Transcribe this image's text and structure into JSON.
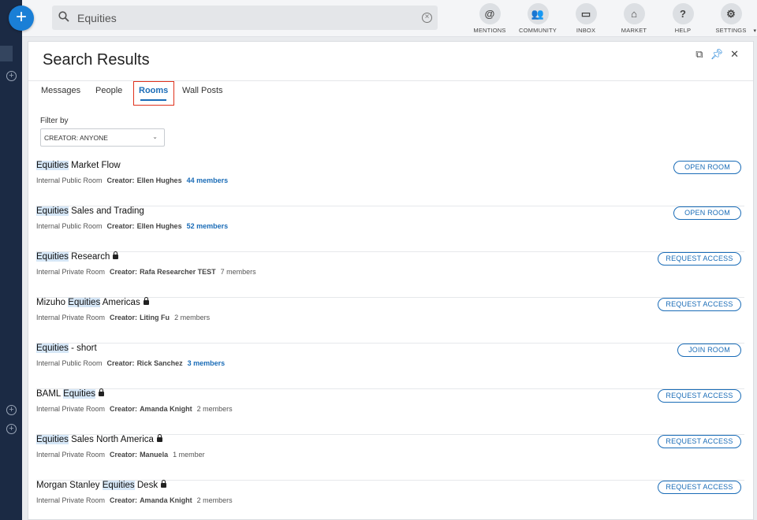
{
  "search": {
    "query": "Equities"
  },
  "nav": [
    {
      "label": "MENTIONS",
      "glyph": "@"
    },
    {
      "label": "COMMUNITY",
      "glyph": "👥"
    },
    {
      "label": "INBOX",
      "glyph": "▭"
    },
    {
      "label": "MARKET",
      "glyph": "⌂"
    },
    {
      "label": "HELP",
      "glyph": "?"
    },
    {
      "label": "SETTINGS",
      "glyph": "⚙"
    }
  ],
  "panel": {
    "title": "Search Results"
  },
  "tabs": [
    "Messages",
    "People",
    "Rooms",
    "Wall Posts"
  ],
  "active_tab": "Rooms",
  "filter": {
    "label": "Filter by",
    "value": "CREATOR: ANYONE"
  },
  "creator_label": "Creator:",
  "rooms": [
    {
      "pre": "",
      "hl": "Equities",
      "post": " Market Flow",
      "private": false,
      "type": "Internal Public Room",
      "creator": "Ellen Hughes",
      "members": "44 members",
      "members_link": true,
      "action": "OPEN ROOM"
    },
    {
      "pre": "",
      "hl": "Equities",
      "post": " Sales and Trading",
      "private": false,
      "type": "Internal Public Room",
      "creator": "Ellen Hughes",
      "members": "52 members",
      "members_link": true,
      "action": "OPEN ROOM"
    },
    {
      "pre": "",
      "hl": "Equities",
      "post": " Research",
      "private": true,
      "type": "Internal Private Room",
      "creator": "Rafa Researcher TEST",
      "members": "7 members",
      "members_link": false,
      "action": "REQUEST ACCESS"
    },
    {
      "pre": "Mizuho ",
      "hl": "Equities",
      "post": " Americas",
      "private": true,
      "type": "Internal Private Room",
      "creator": "Liting Fu",
      "members": "2 members",
      "members_link": false,
      "action": "REQUEST ACCESS"
    },
    {
      "pre": "",
      "hl": "Equities",
      "post": " - short",
      "private": false,
      "type": "Internal Public Room",
      "creator": "Rick Sanchez",
      "members": "3 members",
      "members_link": true,
      "action": "JOIN ROOM"
    },
    {
      "pre": "BAML ",
      "hl": "Equities",
      "post": "",
      "private": true,
      "type": "Internal Private Room",
      "creator": "Amanda Knight",
      "members": "2 members",
      "members_link": false,
      "action": "REQUEST ACCESS"
    },
    {
      "pre": "",
      "hl": "Equities",
      "post": " Sales North America",
      "private": true,
      "type": "Internal Private Room",
      "creator": "Manuela",
      "members": "1 member",
      "members_link": false,
      "action": "REQUEST ACCESS"
    },
    {
      "pre": "Morgan Stanley ",
      "hl": "Equities",
      "post": " Desk",
      "private": true,
      "type": "Internal Private Room",
      "creator": "Amanda Knight",
      "members": "2 members",
      "members_link": false,
      "action": "REQUEST ACCESS"
    }
  ]
}
